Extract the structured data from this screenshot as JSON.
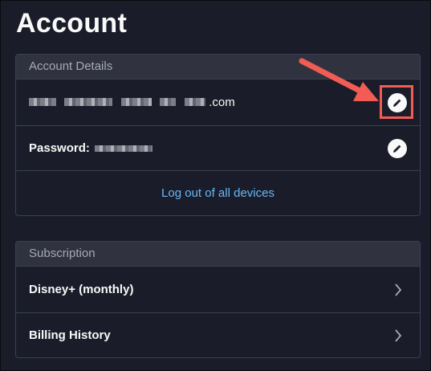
{
  "page": {
    "title": "Account"
  },
  "account_details": {
    "header": "Account Details",
    "email_suffix": ".com",
    "password_label": "Password:",
    "logout_link": "Log out of all devices"
  },
  "subscription": {
    "header": "Subscription",
    "items": [
      {
        "label": "Disney+ (monthly)"
      },
      {
        "label": "Billing History"
      }
    ]
  },
  "icons": {
    "edit": "pencil-icon",
    "chevron": "chevron-right-icon",
    "annotation": "red-arrow-icon"
  },
  "colors": {
    "background": "#1a1d29",
    "header_bg": "#30333f",
    "link": "#67b7f7",
    "annotation": "#f25c54"
  }
}
